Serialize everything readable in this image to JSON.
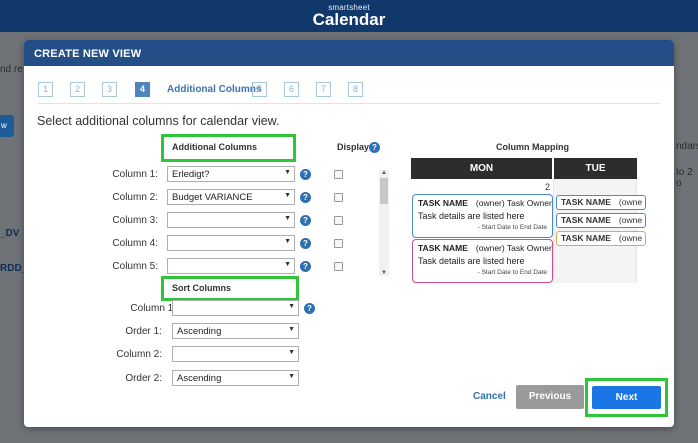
{
  "app": {
    "brand_small": "smartsheet",
    "brand_big": "Calendar"
  },
  "background": {
    "left_text": "nd re",
    "button_text": "w",
    "link1": "_DV",
    "link2": "RDD_",
    "right_text1": "ndars",
    "right_text2": "to 2 o"
  },
  "modal": {
    "title": "CREATE NEW VIEW",
    "steps": [
      "1",
      "2",
      "3",
      "4",
      "5",
      "6",
      "7",
      "8"
    ],
    "active_step": "4",
    "active_step_label": "Additional Columns",
    "instruction": "Select additional columns for calendar view.",
    "additional_columns": {
      "title": "Additional Columns",
      "display_label": "Display",
      "rows": [
        {
          "label": "Column 1:",
          "value": "Erledigt?"
        },
        {
          "label": "Column 2:",
          "value": "Budget VARIANCE"
        },
        {
          "label": "Column 3:",
          "value": ""
        },
        {
          "label": "Column 4:",
          "value": ""
        },
        {
          "label": "Column 5:",
          "value": ""
        }
      ]
    },
    "sort_columns": {
      "title": "Sort Columns",
      "rows": [
        {
          "label": "Column 1:",
          "value": ""
        },
        {
          "label": "Order 1:",
          "value": "Ascending"
        },
        {
          "label": "Column 2:",
          "value": ""
        },
        {
          "label": "Order 2:",
          "value": "Ascending"
        }
      ]
    },
    "mapping": {
      "title": "Column Mapping",
      "days": [
        "MON",
        "TUE"
      ],
      "day_number": "2",
      "task_name": "TASK NAME",
      "owner": "(owner) Task Owner",
      "owner_short": "(owne",
      "details": "Task details are listed here",
      "dates": "- Start Date to End Date"
    },
    "footer": {
      "cancel": "Cancel",
      "previous": "Previous",
      "next": "Next"
    }
  },
  "colors": {
    "header": "#11386a",
    "modal_header": "#244f86",
    "highlight": "#2fc53a",
    "primary": "#1976e4"
  }
}
